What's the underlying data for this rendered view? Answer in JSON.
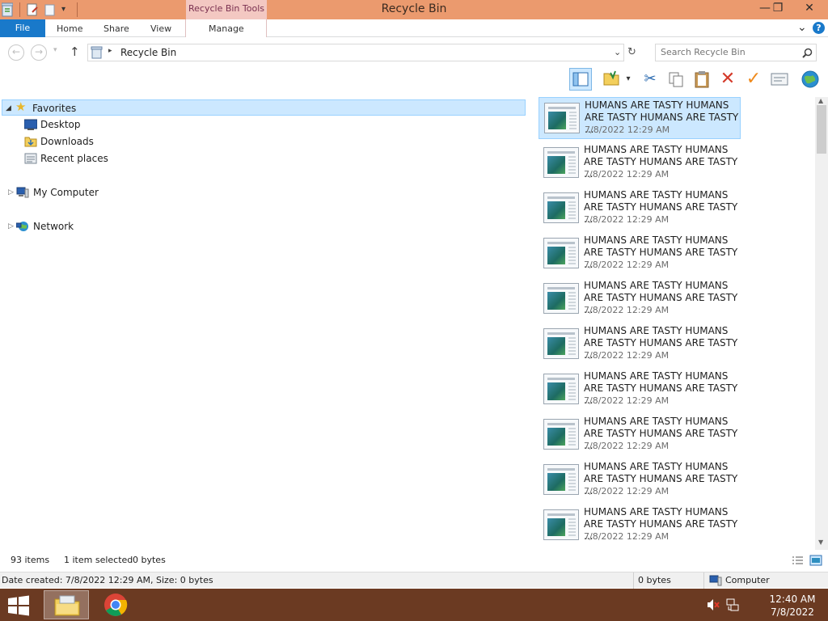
{
  "window": {
    "title": "Recycle Bin",
    "context_tab": "Recycle Bin Tools",
    "controls": {
      "minimize": "—",
      "restore": "❐",
      "close": "✕"
    }
  },
  "ribbon": {
    "file": "File",
    "tabs": [
      "Home",
      "Share",
      "View"
    ],
    "context_tab": "Manage",
    "collapse_glyph": "⌄",
    "help_glyph": "?"
  },
  "address": {
    "path": "Recycle Bin",
    "search_placeholder": "Search Recycle Bin"
  },
  "nav": {
    "favorites": "Favorites",
    "desktop": "Desktop",
    "downloads": "Downloads",
    "recent": "Recent places",
    "my_computer": "My Computer",
    "network": "Network"
  },
  "items": [
    {
      "name": "HUMANS ARE TASTY HUMANS ARE TASTY HUMANS ARE TASTY ...",
      "date": "7/8/2022 12:29 AM",
      "selected": true
    },
    {
      "name": "HUMANS ARE TASTY HUMANS ARE TASTY HUMANS ARE TASTY ...",
      "date": "7/8/2022 12:29 AM"
    },
    {
      "name": "HUMANS ARE TASTY HUMANS ARE TASTY HUMANS ARE TASTY ...",
      "date": "7/8/2022 12:29 AM"
    },
    {
      "name": "HUMANS ARE TASTY HUMANS ARE TASTY HUMANS ARE TASTY ...",
      "date": "7/8/2022 12:29 AM"
    },
    {
      "name": "HUMANS ARE TASTY HUMANS ARE TASTY HUMANS ARE TASTY ...",
      "date": "7/8/2022 12:29 AM"
    },
    {
      "name": "HUMANS ARE TASTY HUMANS ARE TASTY HUMANS ARE TASTY ...",
      "date": "7/8/2022 12:29 AM"
    },
    {
      "name": "HUMANS ARE TASTY HUMANS ARE TASTY HUMANS ARE TASTY ...",
      "date": "7/8/2022 12:29 AM"
    },
    {
      "name": "HUMANS ARE TASTY HUMANS ARE TASTY HUMANS ARE TASTY ...",
      "date": "7/8/2022 12:29 AM"
    },
    {
      "name": "HUMANS ARE TASTY HUMANS ARE TASTY HUMANS ARE TASTY ...",
      "date": "7/8/2022 12:29 AM"
    },
    {
      "name": "HUMANS ARE TASTY HUMANS ARE TASTY HUMANS ARE TASTY ...",
      "date": "7/8/2022 12:29 AM"
    }
  ],
  "status": {
    "count": "93 items",
    "selection": "1 item selected",
    "size": "0 bytes",
    "details": "Date created: 7/8/2022 12:29 AM, Size: 0 bytes",
    "details_size": "0 bytes",
    "zone": "Computer"
  },
  "taskbar": {
    "time": "12:40 AM",
    "date": "7/8/2022"
  },
  "colors": {
    "titlebar": "#eb9a6e",
    "file_tab": "#1979ca",
    "selection": "#cce8ff",
    "taskbar": "#6b3a22"
  }
}
